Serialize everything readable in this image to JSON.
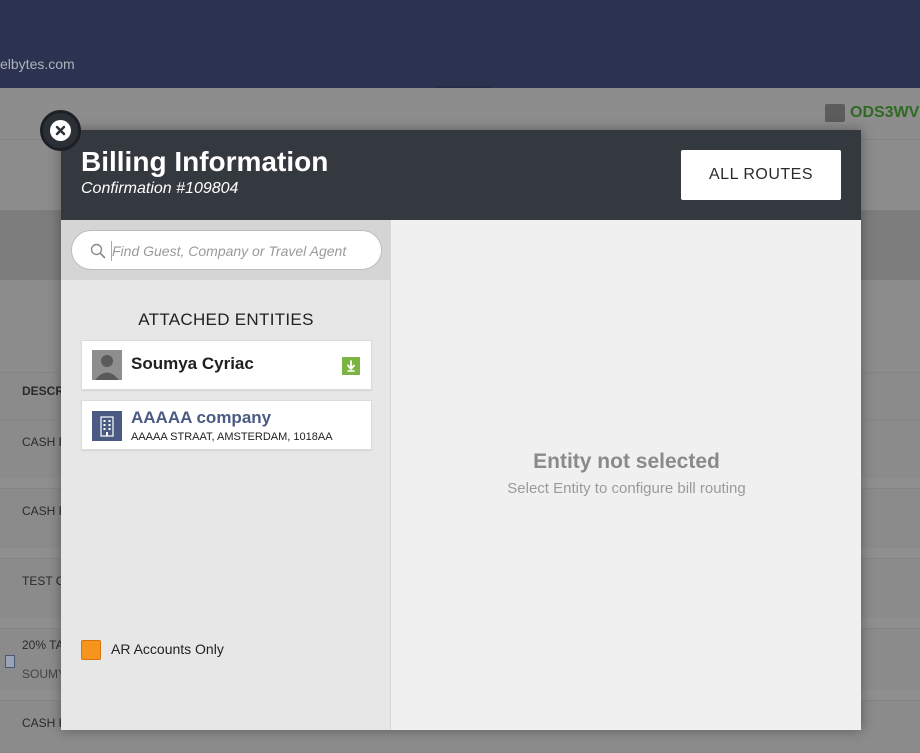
{
  "background": {
    "site_url": "elbytes.com",
    "code": "ODS3WV",
    "column_header": "DESCR",
    "rows": [
      {
        "label": "CASH F",
        "sub": ""
      },
      {
        "label": "CASH F",
        "sub": ""
      },
      {
        "label": "TEST C",
        "sub": ""
      },
      {
        "label": "20% TA",
        "sub": "SOUMY"
      },
      {
        "label": "CASH F",
        "sub": ""
      }
    ]
  },
  "modal": {
    "title": "Billing Information",
    "confirmation": "Confirmation #109804",
    "all_routes_label": "ALL ROUTES",
    "search": {
      "placeholder": "Find Guest, Company or Travel Agent",
      "value": ""
    },
    "attached_entities_title": "ATTACHED ENTITIES",
    "entities": [
      {
        "name": "Soumya Cyriac",
        "type": "guest"
      },
      {
        "name": "AAAAA company",
        "address": "AAAAA STRAAT, AMSTERDAM, 1018AA",
        "type": "company"
      }
    ],
    "ar_accounts_label": "AR Accounts Only",
    "ar_accounts_color": "#f7941d",
    "empty_state": {
      "title": "Entity not selected",
      "subtitle": "Select Entity to configure bill routing"
    }
  }
}
